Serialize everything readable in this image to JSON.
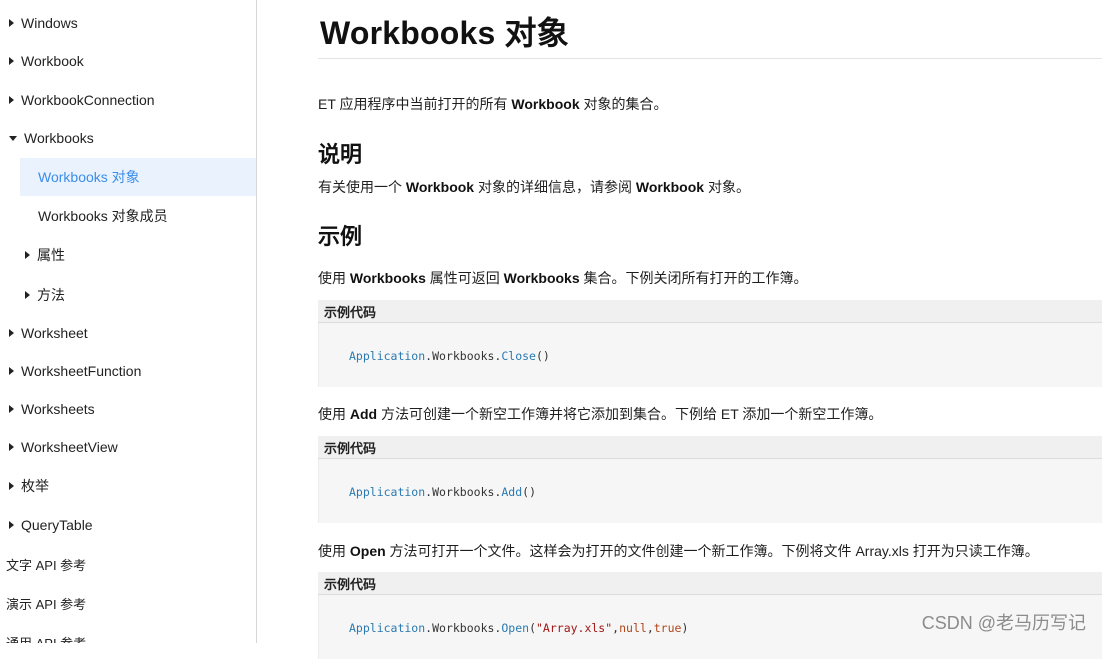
{
  "sidebar": {
    "items": [
      {
        "label": "Windows"
      },
      {
        "label": "Workbook"
      },
      {
        "label": "WorkbookConnection"
      },
      {
        "label": "Workbooks"
      },
      {
        "label": "Workbooks 对象"
      },
      {
        "label": "Workbooks 对象成员"
      },
      {
        "label": "属性"
      },
      {
        "label": "方法"
      },
      {
        "label": "Worksheet"
      },
      {
        "label": "WorksheetFunction"
      },
      {
        "label": "Worksheets"
      },
      {
        "label": "WorksheetView"
      },
      {
        "label": "枚举"
      },
      {
        "label": "QueryTable"
      },
      {
        "label": "文字 API 参考"
      },
      {
        "label": "演示 API 参考"
      },
      {
        "label": "通用 API 参考"
      }
    ]
  },
  "main": {
    "title": "Workbooks 对象",
    "intro": {
      "pre": "ET 应用程序中当前打开的所有 ",
      "bold": "Workbook",
      "post": " 对象的集合。"
    },
    "remarks_heading": "说明",
    "remarks": {
      "pre": "有关使用一个 ",
      "bold1": "Workbook",
      "mid": " 对象的详细信息，请参阅 ",
      "bold2": "Workbook",
      "post": " 对象。"
    },
    "example_heading": "示例",
    "ex1_text": {
      "pre": "使用 ",
      "bold1": "Workbooks",
      "mid": " 属性可返回 ",
      "bold2": "Workbooks",
      "post": " 集合。下例关闭所有打开的工作簿。"
    },
    "code_header": "示例代码",
    "code1": {
      "obj": "Application",
      "coll": "Workbooks",
      "method": "Close",
      "args": "()"
    },
    "ex2_text": {
      "pre": "使用 ",
      "bold": "Add",
      "post": " 方法可创建一个新空工作簿并将它添加到集合。下例给 ET 添加一个新空工作簿。"
    },
    "code2": {
      "obj": "Application",
      "coll": "Workbooks",
      "method": "Add",
      "args": "()"
    },
    "ex3_text": {
      "pre": "使用 ",
      "bold": "Open",
      "post": " 方法可打开一个文件。这样会为打开的文件创建一个新工作簿。下例将文件 Array.xls 打开为只读工作簿。"
    },
    "code3": {
      "obj": "Application",
      "coll": "Workbooks",
      "method": "Open",
      "open": "(",
      "str": "\"Array.xls\"",
      "c1": ",",
      "null": "null",
      "c2": ",",
      "true": "true",
      "close": ")"
    }
  },
  "watermark": "CSDN @老马历写记"
}
